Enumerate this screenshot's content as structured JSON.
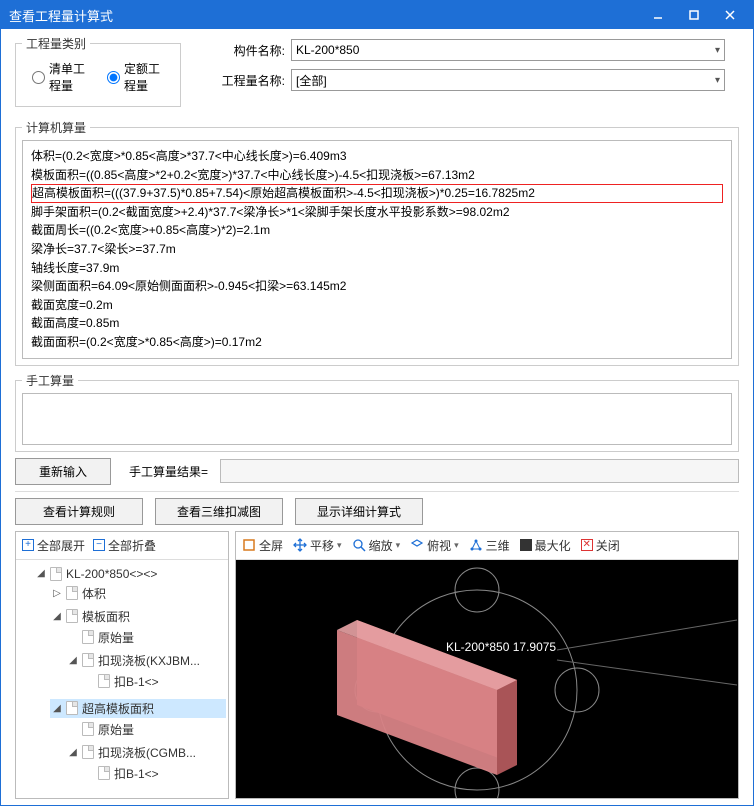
{
  "window": {
    "title": "查看工程量计算式"
  },
  "category": {
    "legend": "工程量类别",
    "list_label": "清单工程量",
    "quota_label": "定额工程量",
    "selected": "quota"
  },
  "form": {
    "component_name_label": "构件名称:",
    "component_name_value": "KL-200*850",
    "quantity_name_label": "工程量名称:",
    "quantity_name_value": "[全部]"
  },
  "calc": {
    "legend": "计算机算量",
    "lines": [
      "体积=(0.2<宽度>*0.85<高度>*37.7<中心线长度>)=6.409m3",
      "模板面积=((0.85<高度>*2+0.2<宽度>)*37.7<中心线长度>)-4.5<扣现浇板>=67.13m2",
      "超高模板面积=(((37.9+37.5)*0.85+7.54)<原始超高模板面积>-4.5<扣现浇板>)*0.25=16.7825m2",
      "脚手架面积=(0.2<截面宽度>+2.4)*37.7<梁净长>*1<梁脚手架长度水平投影系数>=98.02m2",
      "截面周长=((0.2<宽度>+0.85<高度>)*2)=2.1m",
      "梁净长=37.7<梁长>=37.7m",
      "轴线长度=37.9m",
      "梁侧面面积=64.09<原始侧面面积>-0.945<扣梁>=63.145m2",
      "截面宽度=0.2m",
      "截面高度=0.85m",
      "截面面积=(0.2<宽度>*0.85<高度>)=0.17m2"
    ],
    "highlight_index": 2
  },
  "manual": {
    "legend": "手工算量",
    "value": ""
  },
  "buttonrow": {
    "reinput": "重新输入",
    "result_label": "手工算量结果=",
    "result_value": ""
  },
  "actions": {
    "view_rule": "查看计算规则",
    "view_3d": "查看三维扣减图",
    "show_detail": "显示详细计算式"
  },
  "tree_toolbar": {
    "expand_all": "全部展开",
    "collapse_all": "全部折叠"
  },
  "tree": {
    "root": "KL-200*850<><>",
    "n1": "体积",
    "n2": "模板面积",
    "n2a": "原始量",
    "n2b": "扣现浇板(KXJBM...",
    "n2b1": "扣B-1<>",
    "n3": "超高模板面积",
    "n3a": "原始量",
    "n3b": "扣现浇板(CGMB...",
    "n3b1": "扣B-1<>"
  },
  "viewer_toolbar": {
    "fullscreen": "全屏",
    "pan": "平移",
    "zoom": "缩放",
    "top": "俯视",
    "three_d": "三维",
    "maximize": "最大化",
    "close": "关闭"
  },
  "viewer": {
    "label": "KL-200*850 17.9075"
  }
}
